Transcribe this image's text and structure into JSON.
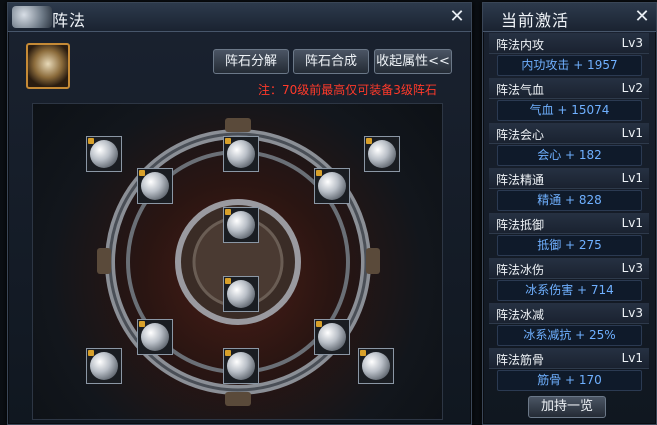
{
  "left_window": {
    "title": "阵法",
    "buttons": {
      "decompose": "阵石分解",
      "combine": "阵石合成",
      "collapse": "收起属性<<"
    },
    "notice": "注：70级前最高仅可装备3级阵石"
  },
  "right_window": {
    "title": "当前激活",
    "rows": [
      {
        "name": "阵法内攻",
        "level": "Lv3",
        "bonus": "内功攻击 + 1957"
      },
      {
        "name": "阵法气血",
        "level": "Lv2",
        "bonus": "气血 + 15074"
      },
      {
        "name": "阵法会心",
        "level": "Lv1",
        "bonus": "会心 + 182"
      },
      {
        "name": "阵法精通",
        "level": "Lv1",
        "bonus": "精通 + 828"
      },
      {
        "name": "阵法抵御",
        "level": "Lv1",
        "bonus": "抵御 + 275"
      },
      {
        "name": "阵法冰伤",
        "level": "Lv3",
        "bonus": "冰系伤害 + 714"
      },
      {
        "name": "阵法冰减",
        "level": "Lv3",
        "bonus": "冰系减抗 + 25%"
      },
      {
        "name": "阵法筋骨",
        "level": "Lv1",
        "bonus": "筋骨 + 170"
      }
    ],
    "footer_button": "加持一览"
  },
  "colors": {
    "notice": "#ff3a2a",
    "bonus_text": "#6fb0ff",
    "slot_lock": "#d8a02a"
  },
  "icons": {
    "close": "close-icon",
    "stone": "formation-stone-icon",
    "lock": "lock-icon"
  }
}
